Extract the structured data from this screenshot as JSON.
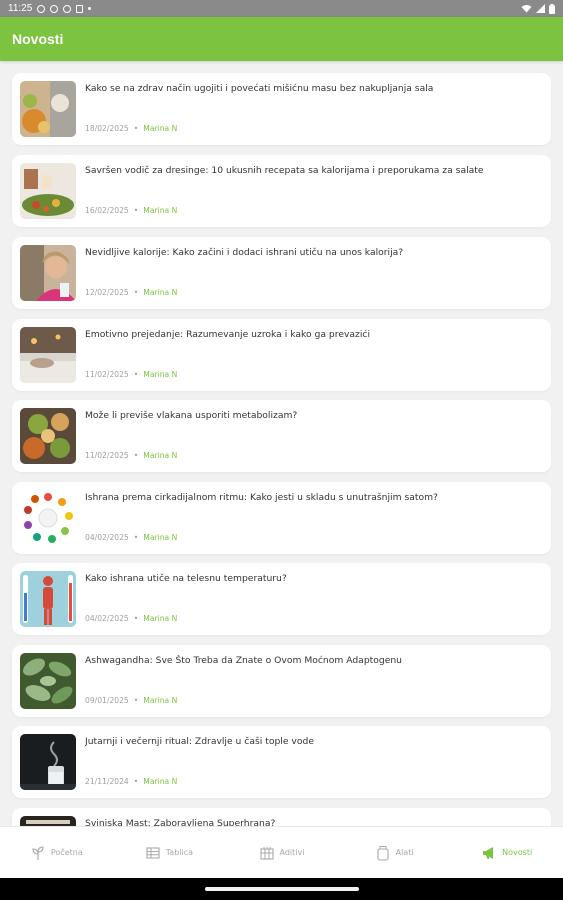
{
  "status": {
    "time": "11:25"
  },
  "app": {
    "title": "Novosti"
  },
  "articles": [
    {
      "title": "Kako se na zdrav način ugojiti i povećati mišićnu masu bez nakupljanja sala",
      "date": "18/02/2025",
      "sep": "•",
      "author": "Marina N"
    },
    {
      "title": "Savršen vodič za dresinge: 10 ukusnih recepata sa kalorijama i preporukama za salate",
      "date": "16/02/2025",
      "sep": "•",
      "author": "Marina N"
    },
    {
      "title": "Nevidljive kalorije: Kako začini i dodaci ishrani utiču na unos kalorija?",
      "date": "12/02/2025",
      "sep": "•",
      "author": "Marina N"
    },
    {
      "title": "Emotivno prejedanje: Razumevanje uzroka i kako ga prevazići",
      "date": "11/02/2025",
      "sep": "•",
      "author": "Marina N"
    },
    {
      "title": "Može li previše vlakana usporiti metabolizam?",
      "date": "11/02/2025",
      "sep": "•",
      "author": "Marina N"
    },
    {
      "title": "Ishrana prema cirkadijalnom ritmu: Kako jesti u skladu s unutrašnjim satom?",
      "date": "04/02/2025",
      "sep": "•",
      "author": "Marina N"
    },
    {
      "title": "Kako ishrana utiče na telesnu temperaturu?",
      "date": "04/02/2025",
      "sep": "•",
      "author": "Marina N"
    },
    {
      "title": "Ashwagandha: Sve Što Treba da Znate o Ovom Moćnom Adaptogenu",
      "date": "09/01/2025",
      "sep": "•",
      "author": "Marina N"
    },
    {
      "title": "Jutarnji i večernji ritual: Zdravlje u čaši tople vode",
      "date": "21/11/2024",
      "sep": "•",
      "author": "Marina N"
    },
    {
      "title": "Svinjska Mast: Zaboravljena Superhrana?",
      "date": "",
      "sep": "",
      "author": ""
    }
  ],
  "nav": {
    "home": "Početna",
    "table": "Tablica",
    "additives": "Aditivi",
    "tools": "Alati",
    "news": "Novosti"
  },
  "icons": {
    "home": "sprout-icon",
    "table": "table-icon",
    "additives": "additive-grid-icon",
    "tools": "jar-icon",
    "news": "megaphone-icon"
  },
  "colors": {
    "accent": "#7cc33f",
    "status_bar": "#8a8a8a",
    "background": "#f1f1f1"
  }
}
